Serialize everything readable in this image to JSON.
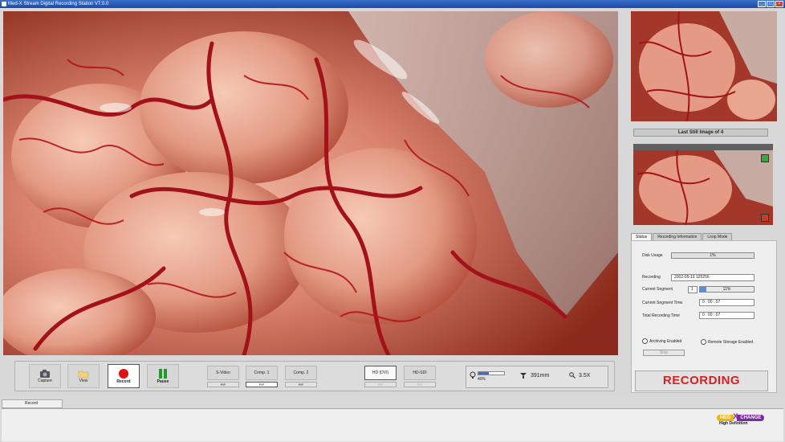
{
  "window": {
    "title": "Med-X Stream Digital Recording Station V7.0.0"
  },
  "colors": {
    "recording_text": "#d82020",
    "title_bar": "#1b4aa6",
    "logo_gold": "#f0b400",
    "logo_purple": "#7a2aa2"
  },
  "still_panel": {
    "title": "Last Still Image of 4"
  },
  "tabs": [
    "Status",
    "Recording Information",
    "Loop Mode"
  ],
  "status": {
    "disk_usage_label": "Disk Usage",
    "disk_usage_value": "1%",
    "recording_label": "Recording",
    "recording_value": "2002-05-13 125256",
    "current_segment_label": "Current Segment",
    "current_segment_value": "1",
    "current_segment_percent": "11%",
    "current_segment_time_label": "Current Segment Time",
    "current_segment_time_value": "0 : 00 : 07",
    "total_recording_time_label": "Total Recording Time",
    "total_recording_time_value": "0 : 00 : 07",
    "archiving_label": "Archiving Enabled",
    "remote_storage_label": "Remote Storage Enabled",
    "small_button_label": "Stop"
  },
  "recording_banner": "RECORDING",
  "toolbar": {
    "capture": "Capture",
    "view": "View",
    "record": "Record",
    "pause": "Pause",
    "inputs": [
      {
        "label": "S-Video",
        "pip": "PIP"
      },
      {
        "label": "Comp. 1",
        "pip": "PIP"
      },
      {
        "label": "Comp. 2",
        "pip": "PIP"
      }
    ],
    "hd_inputs": [
      {
        "label": "HD (DVI)",
        "pip": "PIP"
      },
      {
        "label": "HD-SDI",
        "pip": "PIP"
      }
    ],
    "light_percent": "40%",
    "light_level": 0.4,
    "distance": "391mm",
    "zoom": "3.5X"
  },
  "bottom_tab": "Record",
  "logo": {
    "med": "MED",
    "x": "X",
    "change": "CHANGE",
    "subtitle": "High Definition"
  }
}
